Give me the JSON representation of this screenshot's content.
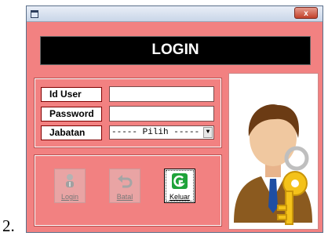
{
  "list_marker": "2.",
  "window": {
    "close_label": "x"
  },
  "header": {
    "title": "LOGIN"
  },
  "form": {
    "user_id_label": "Id User",
    "user_id_value": "",
    "password_label": "Password",
    "password_value": "",
    "role_label": "Jabatan",
    "role_selected": "----- Pilih -----"
  },
  "buttons": {
    "login_label": "Login",
    "cancel_label": "Batal",
    "exit_label": "Keluar"
  },
  "colors": {
    "panel_bg": "#f28181",
    "header_bg": "#000000",
    "exit_icon": "#1fa33a"
  },
  "icons": [
    "app-icon",
    "close-icon",
    "login-icon",
    "undo-icon",
    "exit-icon",
    "user-key-icon"
  ]
}
